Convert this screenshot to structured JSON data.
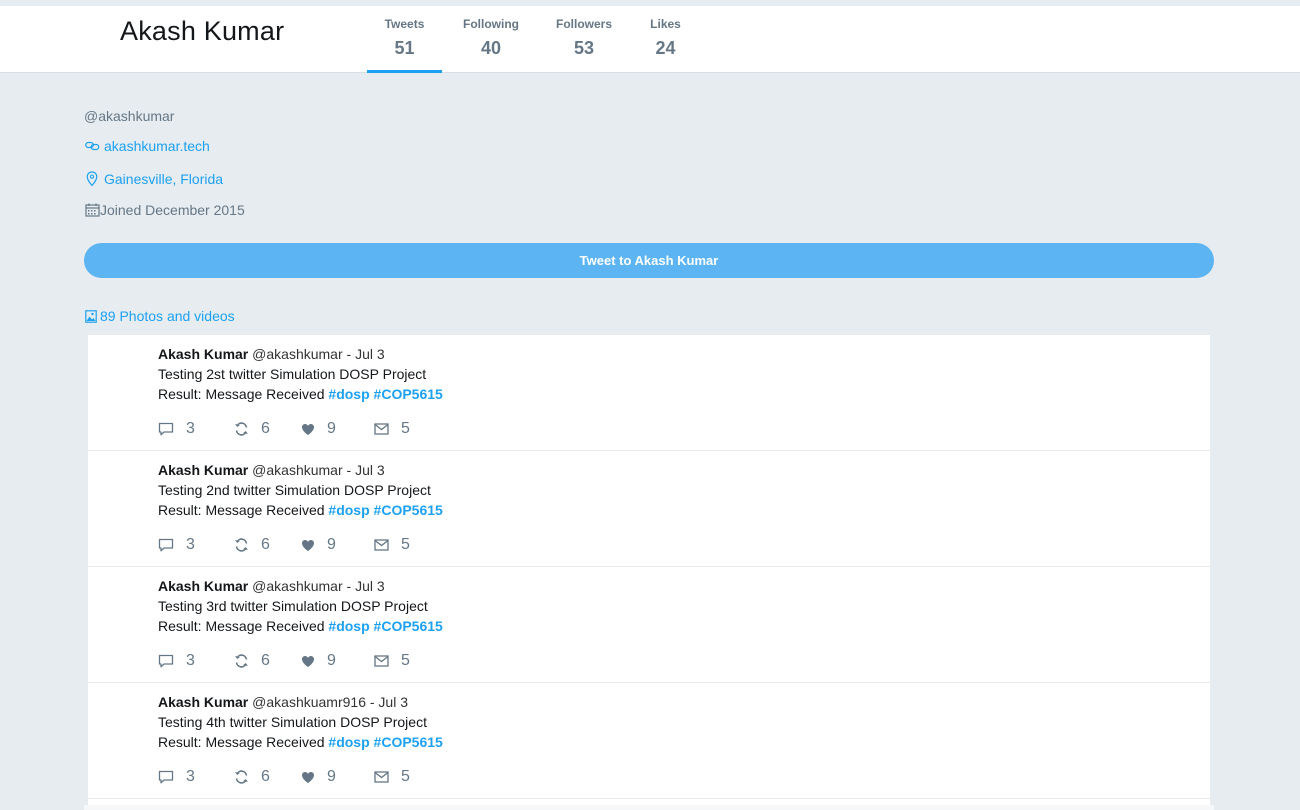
{
  "profile": {
    "name": "Akash Kumar",
    "handle": "@akashkumar",
    "website": "akashkumar.tech",
    "location": "Gainesville, Florida",
    "joined": "Joined December 2015",
    "tweet_to_label": "Tweet to Akash Kumar",
    "photos_label": "89 Photos and videos"
  },
  "stats": [
    {
      "label": "Tweets",
      "value": "51",
      "active": true
    },
    {
      "label": "Following",
      "value": "40"
    },
    {
      "label": "Followers",
      "value": "53"
    },
    {
      "label": "Likes",
      "value": "24"
    }
  ],
  "tweets": [
    {
      "author": "Akash Kumar",
      "meta": "@akashkumar - Jul 3",
      "line1": "Testing 2st twitter Simulation DOSP Project",
      "line2_prefix": "Result: Message Received",
      "hashtag1": "#dosp",
      "hashtag2": "#COP5615",
      "replies": "3",
      "retweets": "6",
      "likes": "9",
      "messages": "5"
    },
    {
      "author": "Akash Kumar",
      "meta": "@akashkumar - Jul 3",
      "line1": "Testing 2nd twitter Simulation DOSP Project",
      "line2_prefix": "Result: Message Received",
      "hashtag1": "#dosp",
      "hashtag2": "#COP5615",
      "replies": "3",
      "retweets": "6",
      "likes": "9",
      "messages": "5"
    },
    {
      "author": "Akash Kumar",
      "meta": "@akashkumar - Jul 3",
      "line1": "Testing 3rd twitter Simulation DOSP Project",
      "line2_prefix": "Result: Message Received",
      "hashtag1": "#dosp",
      "hashtag2": "#COP5615",
      "replies": "3",
      "retweets": "6",
      "likes": "9",
      "messages": "5"
    },
    {
      "author": "Akash Kumar",
      "meta": "@akashkuamr916 - Jul 3",
      "line1": "Testing 4th twitter Simulation DOSP Project",
      "line2_prefix": "Result: Message Received",
      "hashtag1": "#dosp",
      "hashtag2": "#COP5615",
      "replies": "3",
      "retweets": "6",
      "likes": "9",
      "messages": "5"
    }
  ],
  "icons": {
    "website": "link-icon",
    "location": "map-pin-icon",
    "joined": "calendar-icon",
    "photos": "image-icon",
    "reply": "reply-icon",
    "retweet": "retweet-icon",
    "like": "heart-icon",
    "message": "envelope-icon"
  },
  "colors": {
    "accent": "#1da1f2",
    "button": "#5cb4f2",
    "background": "#e6ecf0",
    "muted": "#657786"
  }
}
